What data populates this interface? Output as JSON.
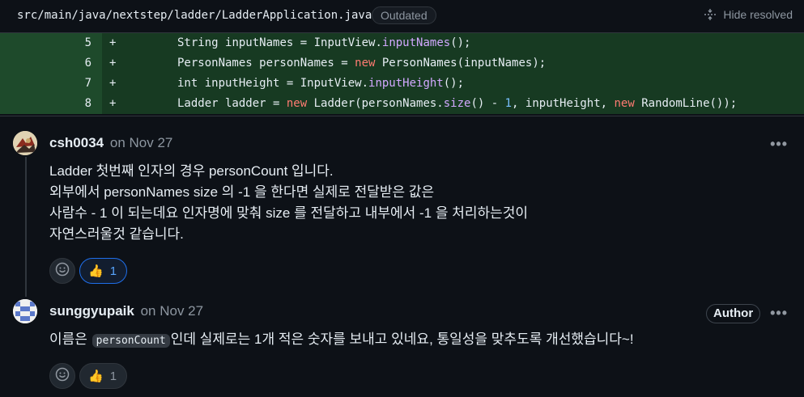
{
  "file_header": {
    "path": "src/main/java/nextstep/ladder/LadderApplication.java",
    "outdated_label": "Outdated",
    "hide_resolved_label": "Hide resolved"
  },
  "diff": {
    "lines": [
      {
        "number": "5",
        "sign": "+",
        "parts": [
          {
            "t": "String "
          },
          {
            "t": "inputNames"
          },
          {
            "t": " = InputView."
          },
          {
            "t": "inputNames",
            "c": "fn"
          },
          {
            "t": "();"
          }
        ]
      },
      {
        "number": "6",
        "sign": "+",
        "parts": [
          {
            "t": "PersonNames personNames = "
          },
          {
            "t": "new",
            "c": "kw"
          },
          {
            "t": " PersonNames(inputNames);"
          }
        ]
      },
      {
        "number": "7",
        "sign": "+",
        "parts": [
          {
            "t": "int inputHeight = InputView."
          },
          {
            "t": "inputHeight",
            "c": "fn"
          },
          {
            "t": "();"
          }
        ]
      },
      {
        "number": "8",
        "sign": "+",
        "parts": [
          {
            "t": "Ladder ladder = "
          },
          {
            "t": "new",
            "c": "kw"
          },
          {
            "t": " Ladder(personNames."
          },
          {
            "t": "size",
            "c": "fn"
          },
          {
            "t": "() - "
          },
          {
            "t": "1",
            "c": "num"
          },
          {
            "t": ", inputHeight, "
          },
          {
            "t": "new",
            "c": "kw"
          },
          {
            "t": " RandomLine());"
          }
        ]
      }
    ]
  },
  "comments": [
    {
      "username": "csh0034",
      "date": "on Nov 27",
      "more_label": "•••",
      "body": [
        "Ladder 첫번째 인자의 경우 personCount 입니다.",
        "외부에서 personNames size 의 -1 을 한다면 실제로 전달받은 값은",
        "사람수 - 1 이 되는데요 인자명에 맞춰 size 를 전달하고 내부에서 -1 을 처리하는것이",
        "자연스러울것 같습니다."
      ],
      "reactions": {
        "thumbs_up_count": "1",
        "emoji": "👍"
      }
    },
    {
      "username": "sunggyupaik",
      "date": "on Nov 27",
      "more_label": "•••",
      "author_badge": "Author",
      "body_before": "이름은 ",
      "inline_code": "personCount",
      "body_after": "인데 실제로는 1개 적은 숫자를 보내고 있네요, 통일성을 맞추도록 개선했습니다~!",
      "reactions": {
        "thumbs_up_count": "1",
        "emoji": "👍"
      }
    }
  ],
  "colors": {
    "background": "#0d1117",
    "diff_added_code": "#173a22",
    "diff_added_gutter": "#1e4a2b",
    "accent": "#1f6feb"
  }
}
